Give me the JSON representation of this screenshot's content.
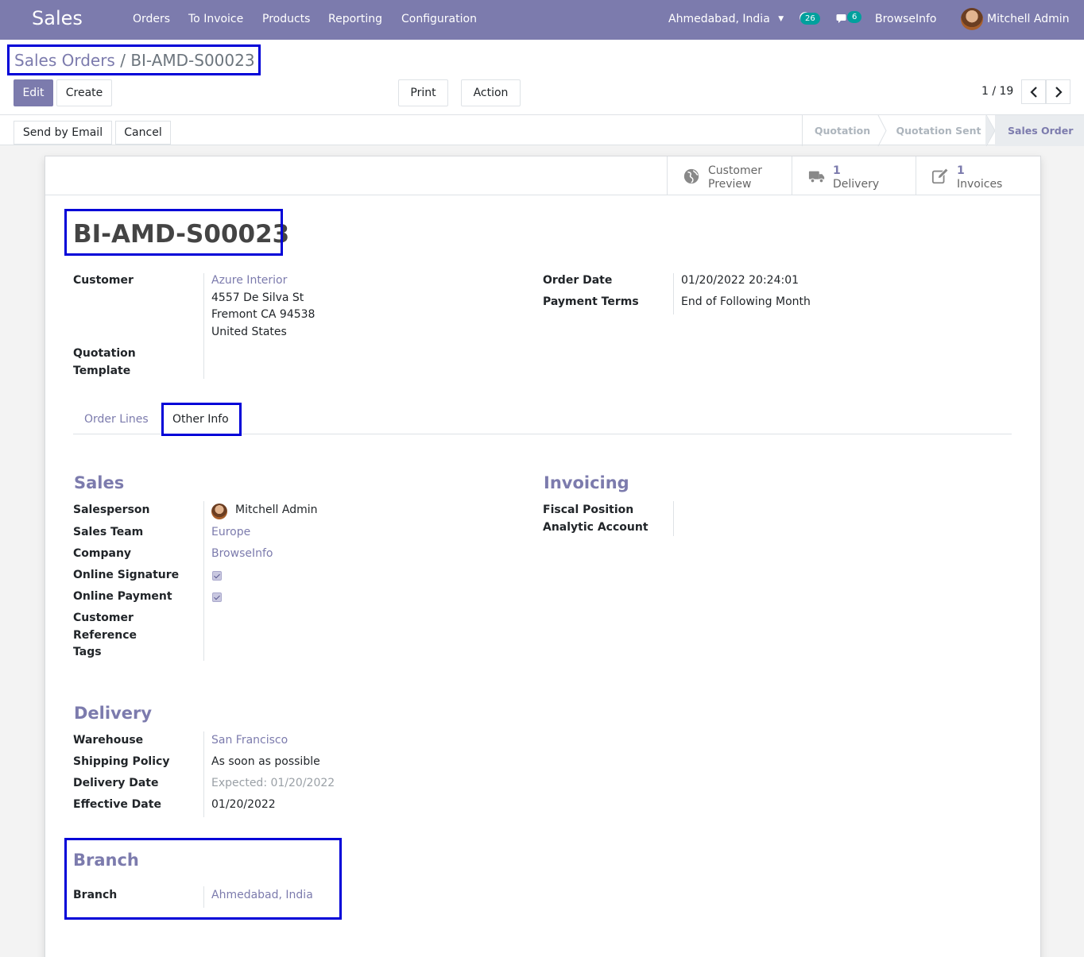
{
  "nav": {
    "app": "Sales",
    "menu": [
      "Orders",
      "To Invoice",
      "Products",
      "Reporting",
      "Configuration"
    ],
    "branch": "Ahmedabad, India",
    "activity_count": "26",
    "message_count": "6",
    "company": "BrowseInfo",
    "user": "Mitchell Admin"
  },
  "breadcrumb": {
    "parent": "Sales Orders",
    "sep": " / ",
    "current": "BI-AMD-S00023"
  },
  "buttons": {
    "edit": "Edit",
    "create": "Create",
    "print": "Print",
    "action": "Action"
  },
  "pager": "1 / 19",
  "status": {
    "send_email": "Send by Email",
    "cancel": "Cancel",
    "stages": [
      "Quotation",
      "Quotation Sent",
      "Sales Order"
    ],
    "active_stage": "Sales Order"
  },
  "smart_buttons": {
    "preview": {
      "line1": "Customer",
      "line2": "Preview"
    },
    "delivery": {
      "count": "1",
      "label": "Delivery"
    },
    "invoices": {
      "count": "1",
      "label": "Invoices"
    }
  },
  "order": {
    "name": "BI-AMD-S00023",
    "customer_label": "Customer",
    "customer": "Azure Interior",
    "address": [
      "4557 De Silva St",
      "Fremont CA 94538",
      "United States"
    ],
    "template_label_1": "Quotation",
    "template_label_2": "Template",
    "order_date_label": "Order Date",
    "order_date": "01/20/2022 20:24:01",
    "payment_terms_label": "Payment Terms",
    "payment_terms": "End of Following Month"
  },
  "tabs": {
    "order_lines": "Order Lines",
    "other_info": "Other Info"
  },
  "sales": {
    "title": "Sales",
    "salesperson_label": "Salesperson",
    "salesperson": "Mitchell Admin",
    "team_label": "Sales Team",
    "team": "Europe",
    "company_label": "Company",
    "company": "BrowseInfo",
    "signature_label": "Online Signature",
    "signature_checked": true,
    "payment_label": "Online Payment",
    "payment_checked": true,
    "ref_label_1": "Customer",
    "ref_label_2": "Reference",
    "tags_label": "Tags"
  },
  "invoicing": {
    "title": "Invoicing",
    "fiscal_label": "Fiscal Position",
    "analytic_label": "Analytic Account"
  },
  "delivery": {
    "title": "Delivery",
    "warehouse_label": "Warehouse",
    "warehouse": "San Francisco",
    "policy_label": "Shipping Policy",
    "policy": "As soon as possible",
    "date_label": "Delivery Date",
    "date": "Expected: 01/20/2022",
    "effective_label": "Effective Date",
    "effective": "01/20/2022"
  },
  "branch": {
    "title": "Branch",
    "label": "Branch",
    "value": "Ahmedabad, India"
  },
  "colors": {
    "brand": "#7c7bad",
    "highlight": "#0000d8",
    "badge": "#00a09d"
  }
}
